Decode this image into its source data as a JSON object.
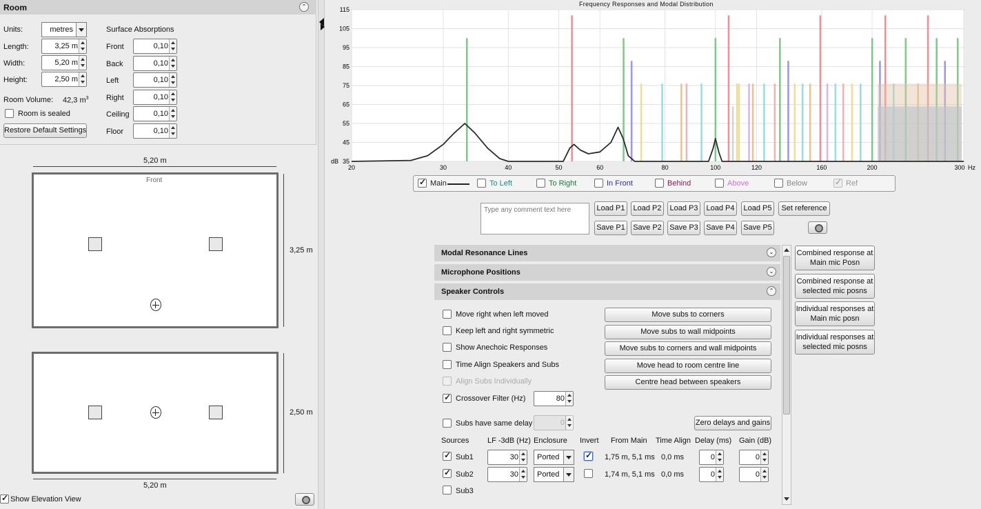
{
  "room_panel": {
    "title": "Room",
    "units_label": "Units:",
    "units_value": "metres",
    "length_label": "Length:",
    "length_value": "3,25 m",
    "width_label": "Width:",
    "width_value": "5,20 m",
    "height_label": "Height:",
    "height_value": "2,50 m",
    "volume_label": "Room Volume:",
    "volume_value": "42,3 m",
    "volume_unit_sup": "3",
    "sealed_label": "Room is sealed",
    "restore_label": "Restore Default Settings",
    "absorptions_title": "Surface Absorptions",
    "surfaces": [
      {
        "name": "Front",
        "value": "0,10"
      },
      {
        "name": "Back",
        "value": "0,10"
      },
      {
        "name": "Left",
        "value": "0,10"
      },
      {
        "name": "Right",
        "value": "0,10"
      },
      {
        "name": "Ceiling",
        "value": "0,10"
      },
      {
        "name": "Floor",
        "value": "0,10"
      }
    ]
  },
  "plan_view": {
    "width_dim": "5,20 m",
    "depth_dim": "3,25 m",
    "front_label": "Front"
  },
  "elevation_view": {
    "width_dim": "5,20 m",
    "height_dim": "2,50 m",
    "show_label": "Show Elevation View"
  },
  "chart_data": {
    "type": "bar",
    "title": "Frequency Responses and Modal Distribution",
    "xlabel": "Hz",
    "ylabel": "dB",
    "xscale": "log",
    "xlim": [
      20,
      300
    ],
    "ylim": [
      35,
      115
    ],
    "x_ticks": [
      20,
      30,
      40,
      50,
      60,
      80,
      100,
      120,
      160,
      200,
      300
    ],
    "y_ticks": [
      35,
      45,
      55,
      65,
      75,
      85,
      95,
      105,
      115
    ],
    "main_response": [
      [
        20,
        35
      ],
      [
        26,
        35.5
      ],
      [
        28,
        38
      ],
      [
        30,
        44
      ],
      [
        31.5,
        50
      ],
      [
        33,
        55
      ],
      [
        34.5,
        50
      ],
      [
        36.5,
        42
      ],
      [
        38.5,
        36.5
      ],
      [
        40,
        35
      ],
      [
        51,
        35
      ],
      [
        52.5,
        42
      ],
      [
        53.5,
        44
      ],
      [
        55,
        41
      ],
      [
        57,
        39
      ],
      [
        60,
        40
      ],
      [
        63,
        45
      ],
      [
        65,
        53
      ],
      [
        66.5,
        47
      ],
      [
        68,
        38
      ],
      [
        70,
        35
      ],
      [
        97,
        35
      ],
      [
        99,
        42
      ],
      [
        100,
        47
      ],
      [
        101.5,
        40
      ],
      [
        103,
        35
      ],
      [
        300,
        35
      ]
    ],
    "modes": [
      {
        "f": 33.3,
        "db": 100,
        "c": "#6cc07a"
      },
      {
        "f": 53,
        "db": 112,
        "c": "#e87e86"
      },
      {
        "f": 66.6,
        "db": 100,
        "c": "#6cc07a"
      },
      {
        "f": 69,
        "db": 88,
        "c": "#8a8ad8"
      },
      {
        "f": 72,
        "db": 76,
        "c": "#e8d88a"
      },
      {
        "f": 79,
        "db": 76,
        "c": "#8ad8d8"
      },
      {
        "f": 86,
        "db": 76,
        "c": "#e8b880"
      },
      {
        "f": 88,
        "db": 76,
        "c": "#e8a8a8"
      },
      {
        "f": 94,
        "db": 76,
        "c": "#8ad8d8"
      },
      {
        "f": 100,
        "db": 100,
        "c": "#6cc07a"
      },
      {
        "f": 106,
        "db": 112,
        "c": "#e87e86"
      },
      {
        "f": 108,
        "db": 64,
        "c": "#cccccc"
      },
      {
        "f": 110,
        "db": 76,
        "c": "#e8d88a"
      },
      {
        "f": 111,
        "db": 76,
        "c": "#e8d88a"
      },
      {
        "f": 116,
        "db": 76,
        "c": "#d8a8e8"
      },
      {
        "f": 118,
        "db": 76,
        "c": "#e8b880"
      },
      {
        "f": 124,
        "db": 76,
        "c": "#8ad8d8"
      },
      {
        "f": 130,
        "db": 76,
        "c": "#e8a8a8"
      },
      {
        "f": 133,
        "db": 100,
        "c": "#6cc07a"
      },
      {
        "f": 138,
        "db": 88,
        "c": "#8a8ad8"
      },
      {
        "f": 142,
        "db": 76,
        "c": "#e8d88a"
      },
      {
        "f": 147,
        "db": 76,
        "c": "#8ad8d8"
      },
      {
        "f": 152,
        "db": 76,
        "c": "#e8b880"
      },
      {
        "f": 159,
        "db": 112,
        "c": "#e87e86"
      },
      {
        "f": 164,
        "db": 76,
        "c": "#d8a8e8"
      },
      {
        "f": 170,
        "db": 76,
        "c": "#8ad8d8"
      },
      {
        "f": 176,
        "db": 76,
        "c": "#e8a8a8"
      },
      {
        "f": 183,
        "db": 76,
        "c": "#e8d88a"
      },
      {
        "f": 190,
        "db": 76,
        "c": "#8ad8d8"
      },
      {
        "f": 200,
        "db": 100,
        "c": "#6cc07a"
      },
      {
        "f": 207,
        "db": 88,
        "c": "#8a8ad8"
      },
      {
        "f": 212,
        "db": 112,
        "c": "#e87e86"
      },
      {
        "f": 220,
        "db": 76,
        "c": "#8ad8d8"
      },
      {
        "f": 232,
        "db": 100,
        "c": "#6cc07a"
      },
      {
        "f": 245,
        "db": 76,
        "c": "#e8b880"
      },
      {
        "f": 256,
        "db": 112,
        "c": "#e87e86"
      },
      {
        "f": 266,
        "db": 100,
        "c": "#6cc07a"
      },
      {
        "f": 276,
        "db": 88,
        "c": "#8a8ad8"
      },
      {
        "f": 292,
        "db": 100,
        "c": "#6cc07a"
      }
    ]
  },
  "legend": [
    {
      "label": "Main",
      "checked": true,
      "color": "#222222"
    },
    {
      "label": "To Left",
      "checked": false,
      "color": "#1a8a8a"
    },
    {
      "label": "To Right",
      "checked": false,
      "color": "#1a7a3a"
    },
    {
      "label": "In Front",
      "checked": false,
      "color": "#2a2aa0"
    },
    {
      "label": "Behind",
      "checked": false,
      "color": "#8a1a5a"
    },
    {
      "label": "Above",
      "checked": false,
      "color": "#d070d0"
    },
    {
      "label": "Below",
      "checked": false,
      "color": "#888888"
    },
    {
      "label": "Ref",
      "checked": true,
      "color": "#999999"
    }
  ],
  "comment_placeholder": "Type any comment text here",
  "load_buttons": [
    "Load P1",
    "Load P2",
    "Load P3",
    "Load P4",
    "Load P5",
    "Set reference"
  ],
  "save_buttons": [
    "Save P1",
    "Save P2",
    "Save P3",
    "Save P4",
    "Save P5"
  ],
  "sections": {
    "modal": "Modal Resonance Lines",
    "mic": "Microphone Positions",
    "speaker": "Speaker Controls"
  },
  "speaker_controls": {
    "options": [
      {
        "label": "Move right when left moved",
        "checked": false,
        "disabled": false
      },
      {
        "label": "Keep left and right symmetric",
        "checked": false,
        "disabled": false
      },
      {
        "label": "Show Anechoic Responses",
        "checked": false,
        "disabled": false
      },
      {
        "label": "Time Align Speakers and Subs",
        "checked": false,
        "disabled": false
      },
      {
        "label": "Align Subs Individually",
        "checked": false,
        "disabled": true
      },
      {
        "label": "Crossover Filter (Hz)",
        "checked": true,
        "disabled": false
      }
    ],
    "crossover_value": "80",
    "same_delay_label": "Subs have same delay",
    "same_delay_value": "0",
    "actions": [
      "Move subs to corners",
      "Move subs to wall midpoints",
      "Move subs to corners and wall midpoints",
      "Move head to room centre line",
      "Centre head between speakers"
    ],
    "zero_label": "Zero delays and gains",
    "table_headers": [
      "Sources",
      "LF -3dB (Hz)",
      "Enclosure",
      "Invert",
      "From Main",
      "Time Align",
      "Delay (ms)",
      "Gain (dB)"
    ],
    "subs": [
      {
        "name": "Sub1",
        "checked": true,
        "lf": "30",
        "enclosure": "Ported",
        "invert": true,
        "from_main": "1,75 m, 5,1 ms",
        "time_align": "0,0 ms",
        "delay": "0",
        "gain": "0"
      },
      {
        "name": "Sub2",
        "checked": true,
        "lf": "30",
        "enclosure": "Ported",
        "invert": false,
        "from_main": "1,74 m, 5,1 ms",
        "time_align": "0,0 ms",
        "delay": "0",
        "gain": "0"
      },
      {
        "name": "Sub3",
        "checked": false
      }
    ]
  },
  "right_buttons": [
    "Combined response at Main mic Posn",
    "Combined response at selected mic posns",
    "Individual responses at Main mic posn",
    "Individual responses at selected mic posns"
  ]
}
